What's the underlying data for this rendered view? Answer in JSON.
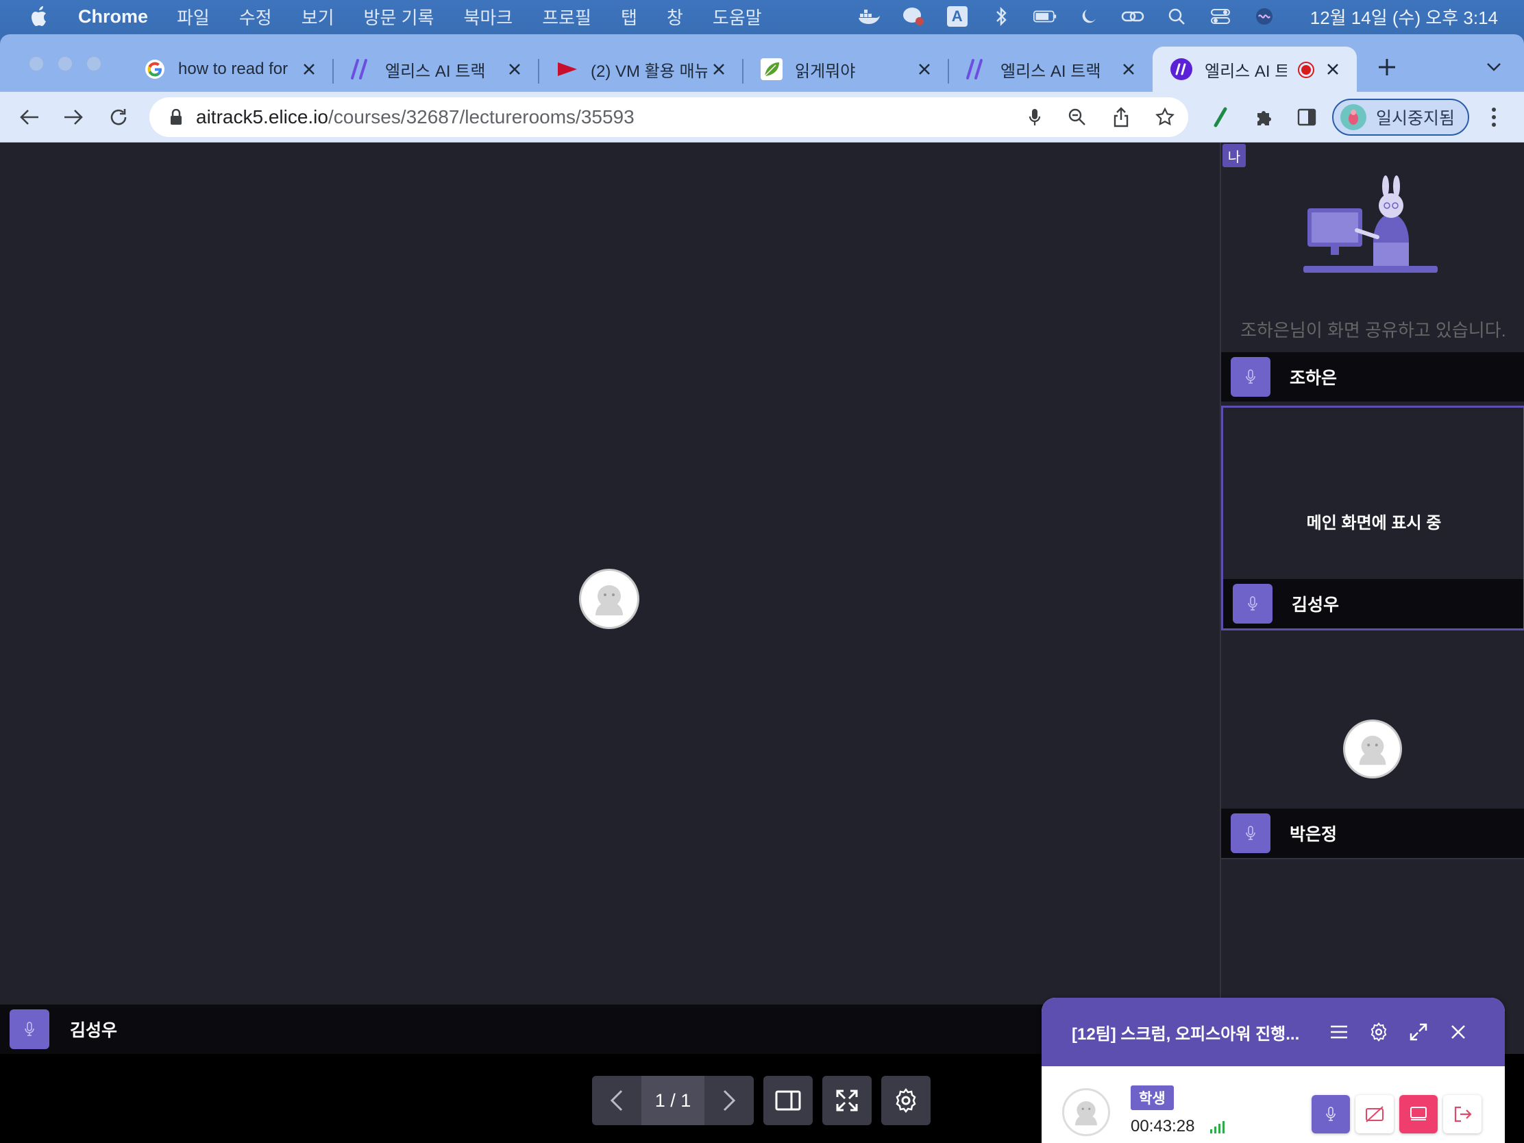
{
  "menubar": {
    "app_name": "Chrome",
    "items": [
      "파일",
      "수정",
      "보기",
      "방문 기록",
      "북마크",
      "프로필",
      "탭",
      "창",
      "도움말"
    ],
    "input_indicator": "A",
    "clock": "12월 14일 (수) 오후 3:14"
  },
  "tabs": [
    {
      "title": "how to read for",
      "favicon": "google-icon"
    },
    {
      "title": "엘리스 AI 트랙",
      "favicon": "elice-slash-icon"
    },
    {
      "title": "(2) VM 활용 매뉴",
      "favicon": "red-flag-icon"
    },
    {
      "title": "읽게뭐야",
      "favicon": "leaf-icon"
    },
    {
      "title": "엘리스 AI 트랙",
      "favicon": "elice-slash-icon"
    },
    {
      "title": "엘리스 AI 트",
      "favicon": "elice-logo-icon",
      "active": true,
      "recording": true
    }
  ],
  "address_bar": {
    "host": "aitrack5.elice.io",
    "path": "/courses/32687/lecturerooms/35593"
  },
  "profile": {
    "label": "일시중지됨"
  },
  "stage": {
    "participant_name": "김성우"
  },
  "pager": {
    "label": "1 / 1"
  },
  "side_panel": {
    "me_badge": "나",
    "tiles": [
      {
        "name": "조하은",
        "status_text": "조하은님이 화면 공유하고 있습니다."
      },
      {
        "name": "김성우",
        "status_text": "메인 화면에 표시 중"
      },
      {
        "name": "박은정"
      }
    ]
  },
  "widget": {
    "title": "[12팀] 스크럼, 오피스아워 진행...",
    "role": "학생",
    "elapsed": "00:43:28"
  },
  "colors": {
    "accent_purple": "#5d4fb0",
    "mic_purple": "#6f63c9",
    "screen_share_pink": "#ef3e6d",
    "stage_bg": "#22222d"
  }
}
